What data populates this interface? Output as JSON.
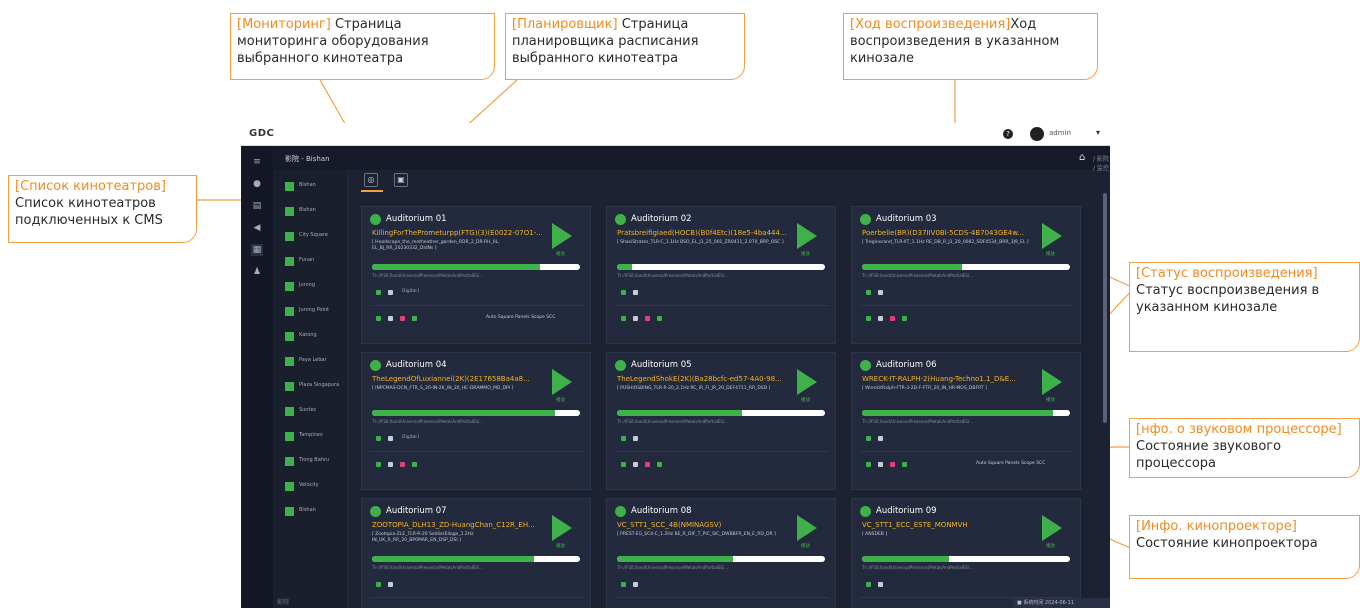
{
  "callouts": {
    "monitoring": {
      "tag": "[Мониторинг]",
      "text": " Страница мониторинга оборудования выбранного кинотеатра"
    },
    "planner": {
      "tag": "[Планировщик]",
      "text": " Страница планировщика расписания выбранного кинотеатра"
    },
    "progress": {
      "tag": "[Ход воспроизведения]",
      "text": "Ход воспроизведения в указанном кинозале"
    },
    "cinema_list": {
      "tag": "[Список кинотеатров]",
      "text": "Список кинотеатров подключенных к CMS"
    },
    "play_status": {
      "tag": "[Статус воспроизведения]",
      "text": "Статус воспроизведения в указанном кинозале"
    },
    "sound": {
      "tag": "[нфо. о звуковом процессоре]",
      "text": "Состояние звукового процессора"
    },
    "projector": {
      "tag": "[Инфо. кинопроекторе]",
      "text": "Состояние кинопроектора"
    }
  },
  "app": {
    "logo": "GDC",
    "help": "?",
    "user": "admin",
    "user_caret": "▾",
    "page_title": "影院 - Bishan",
    "home": "⌂",
    "crumb": "/ 影院 / 监控",
    "footer": "影院"
  },
  "cinemas": [
    "Bishan",
    "Bishan",
    "City Square",
    "Funan",
    "Jurong",
    "Jurong Point",
    "Katong",
    "Paya Lebar",
    "Plaza Singapura",
    "Suntec",
    "Tampines",
    "Tiong Bahru",
    "Velocity",
    "Bishan"
  ],
  "cards": [
    {
      "num": "1",
      "name": "Auditorium 01",
      "movie": "KillingForThePrometurpp(FTG)(3)(E0022-07O1-...",
      "meta": "[ Headscape_the_metheother_garden_RDR_2_DR-RH_0L, EL_BJ_RR_20230332_DIdNs ]",
      "fill": 0.81,
      "time": "01:08:24",
      "sub": "TI-://FS0:/land/UniversalPresence/MetalsAndPartialES/...",
      "row1": "Digital  I",
      "sound": "Auto Square Panels Scope SCC",
      "btn": "播放"
    },
    {
      "num": "2",
      "name": "Auditorium 02",
      "movie": "Pratsbreifigiaed(HOCB)(B0f4Etc)(18e5-4ba444...",
      "meta": "[ ShasiStrates_TLR-C_1.1Hz BSO_EL_J1_25_001_ZR0411_2.070_BRP_OSC ]",
      "fill": 0.07,
      "time": "00:02:44",
      "sub": "TI-://FS0:/land/UniversalPresence/MetalsAndPartialES/...",
      "row1": "",
      "sound": "",
      "btn": "播放"
    },
    {
      "num": "3",
      "name": "Auditorium 03",
      "movie": "Poerbelie(BR)(D37IIV0Bl-5CDS-4B7043GE4w...",
      "meta": "[ Treginorand_TLR-XT_1.1Hz RE_DB_R_J1_20_0082_SDF4534_BRR_3J9_EL ]",
      "fill": 0.48,
      "time": "00:52:08",
      "sub": "TI-://FS0:/land/UniversalPresence/MetalsAndPartialES/...",
      "row1": "",
      "sound": "",
      "btn": "播放"
    },
    {
      "num": "4",
      "name": "Auditorium 04",
      "movie": "TheLegendOfLuxiannei(2K)(2E17658Ba4a8...",
      "meta": "[ INPCMAS-DCN_FTR_S_20-IN-2K_IN_20_HC-DRAMMO_MD_DPI ]",
      "fill": 0.88,
      "time": "02:01:15",
      "sub": "TI-://FS0:/land/UniversalPresence/MetalsAndPartialES/...",
      "row1": "Digital  I",
      "sound": "",
      "btn": "播放"
    },
    {
      "num": "5",
      "name": "Auditorium 05",
      "movie": "TheLegendShokE(2K)(Ba28bcfc-ed57-4A0-98...",
      "meta": "[ PUSHIOSBING_TLR-R-20_2.1Hz RC_IR_FI_JR_20_DEF4711_RR_DSD ]",
      "fill": 0.6,
      "time": "01:10:52",
      "sub": "TI-://FS0:/land/UniversalPresence/MetalsAndPartialES/...",
      "row1": "",
      "sound": "",
      "btn": "播放"
    },
    {
      "num": "6",
      "name": "Auditorium 06",
      "movie": "WRECK-IT-RALPH-2(Huang-Techno1.1_D&E...",
      "meta": "[ WreckitRalph-FTR-3-2D-F-FTR_20_IN_HR-MOS_DBFRT ]",
      "fill": 0.92,
      "time": "01:49:12",
      "sub": "TI-://FS0:/land/UniversalPresence/MetalsAndPartialES/...",
      "row1": "",
      "sound": "Auto Square Panels Scope SCC",
      "btn": "播放"
    },
    {
      "num": "7",
      "name": "Auditorium 07",
      "movie": "ZOOTOPIA_DLH13_ZD-HuangChan_C12R_EH...",
      "meta": "[ Zootopia-ZLE_TLR-R-20 SoldierEllage_1.2Hz IN_UK_R_RR_20_BP0MAR_EN_DSP_DSI ]",
      "fill": 0.78,
      "time": "01:33:05",
      "sub": "TI-://FS0:/land/UniversalPresence/MetalsAndPartialES/...",
      "row1": "",
      "sound": "",
      "btn": "播放"
    },
    {
      "num": "8",
      "name": "Auditorium 08",
      "movie": "VC_STT1_SCC_4B(NMINAGSV)",
      "meta": "[ PREST-EG_SC4-C_1.2Hz BE_R_DIF_T_PIC_SIC_DWBBFR_EN_E_RD_DR ]",
      "fill": 0.56,
      "time": "00:59:30",
      "sub": "TI-://FS0:/land/UniversalPresence/MetalsAndPartialES/...",
      "row1": "",
      "sound": "",
      "btn": "播放"
    },
    {
      "num": "9",
      "name": "Auditorium 09",
      "movie": "VC_STT1_ECC_ESTE_MONMVH",
      "meta": "[ ANSDEB ]",
      "fill": 0.42,
      "time": "00:44:18",
      "sub": "TI-://FS0:/land/UniversalPresence/MetalsAndPartialES/...",
      "row1": "",
      "sound": "",
      "btn": "播放"
    }
  ],
  "status_strip": "■  系统时间 2024-06-11"
}
